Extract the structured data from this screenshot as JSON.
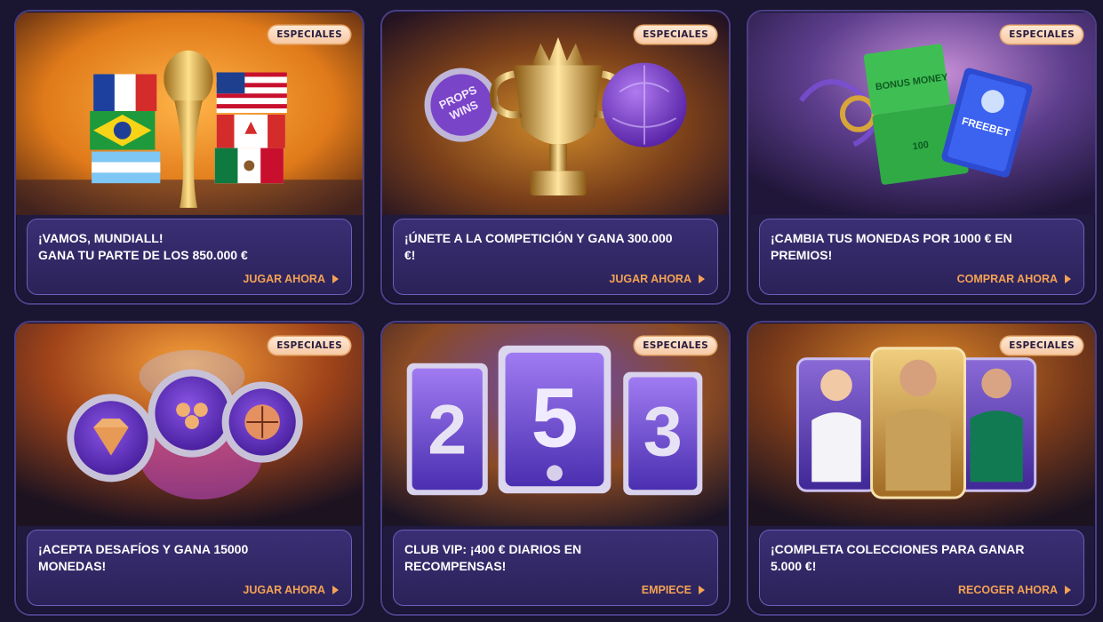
{
  "cards": [
    {
      "badge": "ESPECIALES",
      "title_line1": "¡VAMOS, MUNDIALL!",
      "title_line2": "GANA TU PARTE DE LOS 850.000 €",
      "cta": "JUGAR AHORA",
      "art_icon": "world-cup-trophy-flags",
      "accent": "#e07a1a"
    },
    {
      "badge": "ESPECIALES",
      "title_line1": "¡ÚNETE A LA COMPETICIÓN Y GANA 300.000",
      "title_line2": "€!",
      "cta": "JUGAR AHORA",
      "art_icon": "gold-trophy-props-ball",
      "accent": "#c9861f"
    },
    {
      "badge": "ESPECIALES",
      "title_line1": "¡CAMBIA TUS MONEDAS POR 1000 € EN",
      "title_line2": "PREMIOS!",
      "cta": "COMPRAR AHORA",
      "art_icon": "bonus-money-freebet-tickets",
      "accent": "#8a4fc4"
    },
    {
      "badge": "ESPECIALES",
      "title_line1": "¡ACEPTA DESAFÍOS Y GANA 15000",
      "title_line2": "MONEDAS!",
      "cta": "JUGAR AHORA",
      "art_icon": "challenge-coins",
      "accent": "#d8781c"
    },
    {
      "badge": "ESPECIALES",
      "title_line1": "CLUB VIP: ¡400 € DIARIOS EN",
      "title_line2": "RECOMPENSAS!",
      "cta": "EMPIECE",
      "art_icon": "vip-number-cards",
      "accent": "#c77a23"
    },
    {
      "badge": "ESPECIALES",
      "title_line1": "¡COMPLETA COLECCIONES PARA GANAR",
      "title_line2": "5.000 €!",
      "cta": "RECOGER AHORA",
      "art_icon": "player-collection-cards",
      "accent": "#c9741a"
    }
  ]
}
